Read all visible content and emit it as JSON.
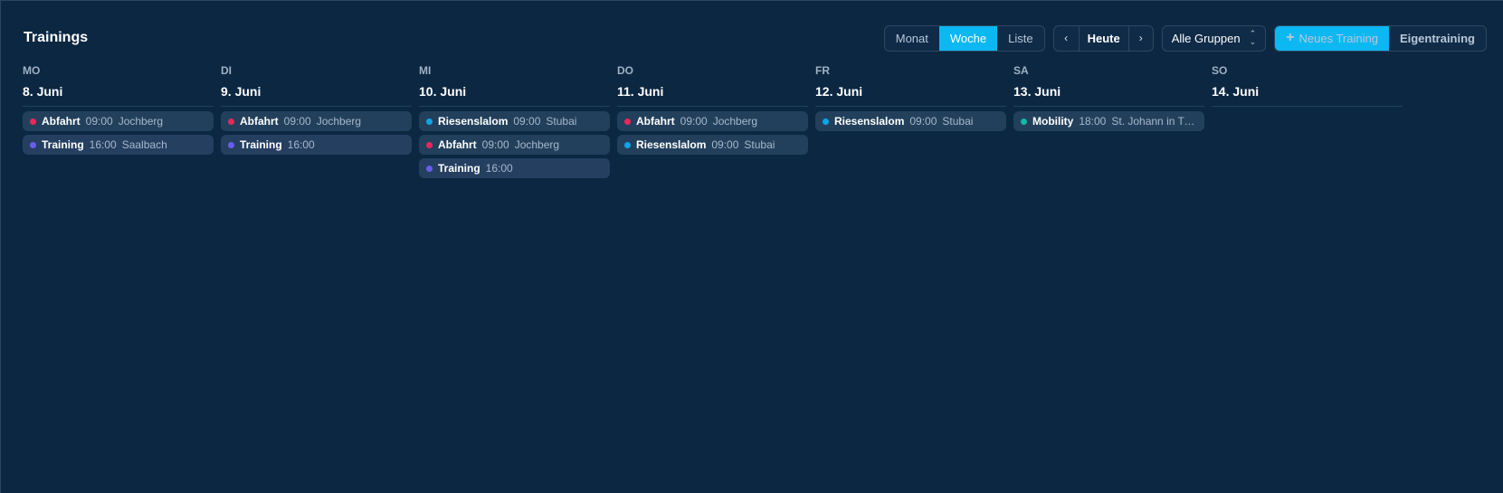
{
  "header": {
    "title": "Trainings",
    "views": [
      "Monat",
      "Woche",
      "Liste"
    ],
    "active_view": "Woche",
    "prev_icon": "chevron-left-icon",
    "today_label": "Heute",
    "next_icon": "chevron-right-icon",
    "group_select": "Alle Gruppen",
    "new_training_label": "Neues Training",
    "own_training_label": "Eigentraining"
  },
  "colors": {
    "accent": "#0cb8f2",
    "abfahrt": "#e8285a",
    "training": "#6a5cf0",
    "riesenslalom": "#0ea5e9",
    "mobility": "#14b8a6"
  },
  "days": [
    {
      "dow": "MO",
      "date": "8. Juni",
      "events": [
        {
          "title": "Abfahrt",
          "time": "09:00",
          "location": "Jochberg",
          "color": "#e8285a"
        },
        {
          "title": "Training",
          "time": "16:00",
          "location": "Saalbach",
          "color": "#6a5cf0"
        }
      ]
    },
    {
      "dow": "DI",
      "date": "9. Juni",
      "events": [
        {
          "title": "Abfahrt",
          "time": "09:00",
          "location": "Jochberg",
          "color": "#e8285a"
        },
        {
          "title": "Training",
          "time": "16:00",
          "location": "",
          "color": "#6a5cf0"
        }
      ]
    },
    {
      "dow": "MI",
      "date": "10. Juni",
      "events": [
        {
          "title": "Riesenslalom",
          "time": "09:00",
          "location": "Stubai",
          "color": "#0ea5e9"
        },
        {
          "title": "Abfahrt",
          "time": "09:00",
          "location": "Jochberg",
          "color": "#e8285a"
        },
        {
          "title": "Training",
          "time": "16:00",
          "location": "",
          "color": "#6a5cf0"
        }
      ]
    },
    {
      "dow": "DO",
      "date": "11. Juni",
      "events": [
        {
          "title": "Abfahrt",
          "time": "09:00",
          "location": "Jochberg",
          "color": "#e8285a"
        },
        {
          "title": "Riesenslalom",
          "time": "09:00",
          "location": "Stubai",
          "color": "#0ea5e9"
        }
      ]
    },
    {
      "dow": "FR",
      "date": "12. Juni",
      "events": [
        {
          "title": "Riesenslalom",
          "time": "09:00",
          "location": "Stubai",
          "color": "#0ea5e9"
        }
      ]
    },
    {
      "dow": "SA",
      "date": "13. Juni",
      "events": [
        {
          "title": "Mobility",
          "time": "18:00",
          "location": "St. Johann in Tir...",
          "color": "#14b8a6"
        }
      ]
    },
    {
      "dow": "SO",
      "date": "14. Juni",
      "events": []
    }
  ]
}
